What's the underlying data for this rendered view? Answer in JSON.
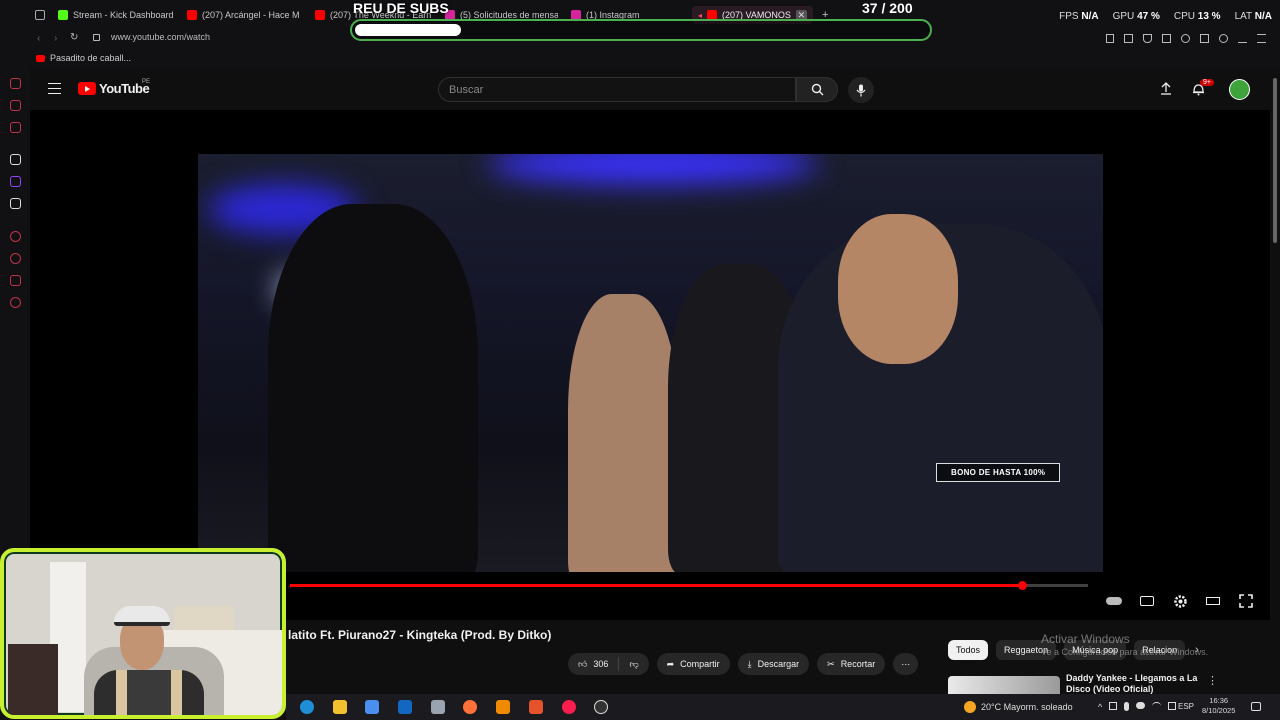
{
  "browser": {
    "tabs": [
      {
        "label": "Stream - Kick Dashboard",
        "favicon_color": "#53fc18"
      },
      {
        "label": "(207) Arcángel - Hace M",
        "favicon_color": "#ff0000"
      },
      {
        "label": "(207) The Weeknd - Earn",
        "favicon_color": "#ff0000"
      },
      {
        "label": "(5) Solicitudes de mensa",
        "favicon_color": "#d6249f"
      },
      {
        "label": "(1) Instagram",
        "favicon_color": "#d6249f"
      },
      {
        "label": "(207) VAMONOS",
        "favicon_color": "#ff0000",
        "active": true
      }
    ],
    "url": "www.youtube.com/watch",
    "bookmark": "Pasadito de caball...",
    "perf": {
      "fps_label": "FPS",
      "fps_value": "N/A",
      "gpu_label": "GPU",
      "gpu_value": "47 %",
      "cpu_label": "CPU",
      "cpu_value": "13 %",
      "lat_label": "LAT",
      "lat_value": "N/A"
    }
  },
  "overlay": {
    "title": "REU DE SUBS",
    "counter": "37 / 200",
    "goal_fraction": 0.185
  },
  "youtube": {
    "logo_text": "YouTube",
    "region": "PE",
    "search_placeholder": "Buscar",
    "notification_badge": "9+",
    "accent": "#ff0000"
  },
  "player": {
    "promo_badge": "BONO DE HASTA 100%",
    "progress_fraction": 0.917,
    "buffered_fraction": 1.0
  },
  "video": {
    "title": "latito Ft. Piurano27 - Kingteka (Prod. By Ditko)",
    "likes": "306",
    "share_label": "Compartir",
    "download_label": "Descargar",
    "clip_label": "Recortar",
    "more_label": "⋯"
  },
  "chips": [
    "Todos",
    "Reggaeton",
    "Música pop",
    "Relacion"
  ],
  "watermark": {
    "title": "Activar Windows",
    "subtitle": "Ve a Configuración para activar Windows."
  },
  "recommendation": {
    "title": "Daddy Yankee - Llegamos a La Disco (Video Oficial)"
  },
  "taskbar": {
    "weather": "20°C  Mayorm. soleado",
    "lang": "ESP",
    "time": "16:36",
    "date": "8/10/2025"
  }
}
